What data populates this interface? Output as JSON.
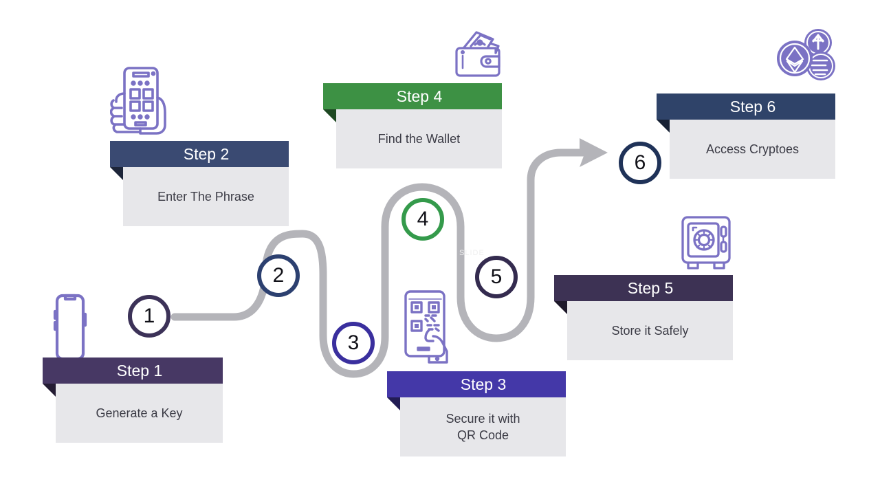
{
  "diagram": {
    "title": "Crypto Wallet Setup Steps",
    "background": "#ffffff",
    "connector_color": "#b4b4b9",
    "body_bg": "#e7e7ea",
    "body_text_color": "#3b3b45",
    "icon_stroke": "#7b72c4",
    "watermark_text": "SLIDE"
  },
  "steps": [
    {
      "id": "step-1",
      "number": "1",
      "header_label": "Step 1",
      "body_label": "Generate a Key",
      "header_color": "#473864",
      "fold_color": "#241c33",
      "marker_color": "#3c3258",
      "icon_name": "phone-icon"
    },
    {
      "id": "step-2",
      "number": "2",
      "header_label": "Step 2",
      "body_label": "Enter The Phrase",
      "header_color": "#3a4a72",
      "fold_color": "#1d2539",
      "marker_color": "#2c4070",
      "icon_name": "hand-holding-phone-icon"
    },
    {
      "id": "step-3",
      "number": "3",
      "header_label": "Step 3",
      "body_label": "Secure it with\nQR Code",
      "header_color": "#4438a8",
      "fold_color": "#221c54",
      "marker_color": "#3a2f9e",
      "icon_name": "qr-scan-phone-icon"
    },
    {
      "id": "step-4",
      "number": "4",
      "header_label": "Step 4",
      "body_label": "Find the Wallet",
      "header_color": "#3d9144",
      "fold_color": "#1e4822",
      "marker_color": "#349a4b",
      "icon_name": "wallet-icon"
    },
    {
      "id": "step-5",
      "number": "5",
      "header_label": "Step 5",
      "body_label": "Store it Safely",
      "header_color": "#3d3254",
      "fold_color": "#1e192a",
      "marker_color": "#342b4f",
      "icon_name": "safe-vault-icon"
    },
    {
      "id": "step-6",
      "number": "6",
      "header_label": "Step 6",
      "body_label": "Access Cryptoes",
      "header_color": "#2f4369",
      "fold_color": "#172134",
      "marker_color": "#1f3258",
      "icon_name": "crypto-coins-icon"
    }
  ]
}
